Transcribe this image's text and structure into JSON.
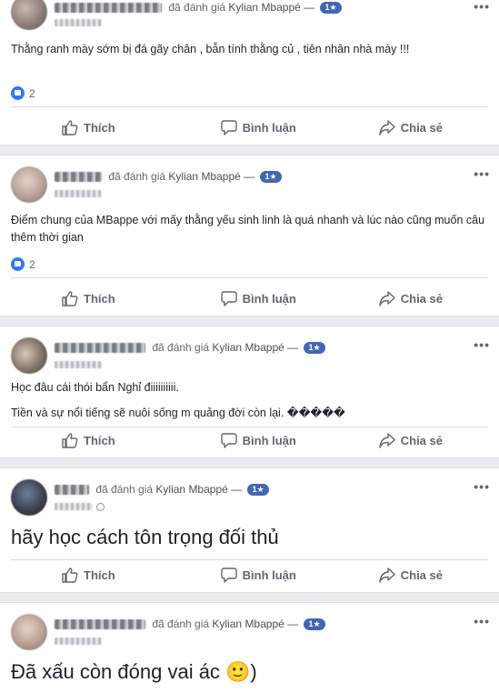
{
  "colors": {
    "page_bg": "#e9ebee",
    "card_bg": "#ffffff",
    "badge": "#4267b2",
    "like_blue": "#2e7bf0",
    "muted": "#606770"
  },
  "reviews": [
    {
      "action": "đã đánh giá",
      "page": "Kylian Mbappé —",
      "badge": "1★",
      "text": "Thằng ranh mày sớm bị đá gãy chân , bẫn tính  thằng củ      , tiên nhân nhà mày !!!",
      "like_count": "2",
      "privacy_icon": ""
    },
    {
      "action": "đã đánh giá",
      "page": "Kylian Mbappé —",
      "badge": "1★",
      "text": "Điểm chung của MBappe với mấy thằng yếu sinh linh là quá nhanh và lúc nào cũng muốn câu thêm thời gian",
      "like_count": "2"
    },
    {
      "action": "đã đánh giá",
      "page": "Kylian Mbappé —",
      "badge": "1★",
      "text_line1": "Học đâu cái thói bẩn      Nghỉ điiiiiiiiii.",
      "text_line2": "Tiền và sự nổi tiếng sẽ nuôi sống m quảng đời còn lại. �����"
    },
    {
      "action": "đã đánh giá",
      "page": "Kylian Mbappé —",
      "badge": "1★",
      "text": "hãy học cách tôn trọng đối thủ",
      "privacy_icon": "globe-icon"
    },
    {
      "action": "đã đánh giá",
      "page": "Kylian Mbappé —",
      "badge": "1★",
      "text": "Đã xấu còn đóng vai ác 🙂)"
    }
  ],
  "actions": {
    "like": "Thích",
    "comment": "Bình luận",
    "share": "Chia sẻ"
  },
  "more_icon": "•••"
}
